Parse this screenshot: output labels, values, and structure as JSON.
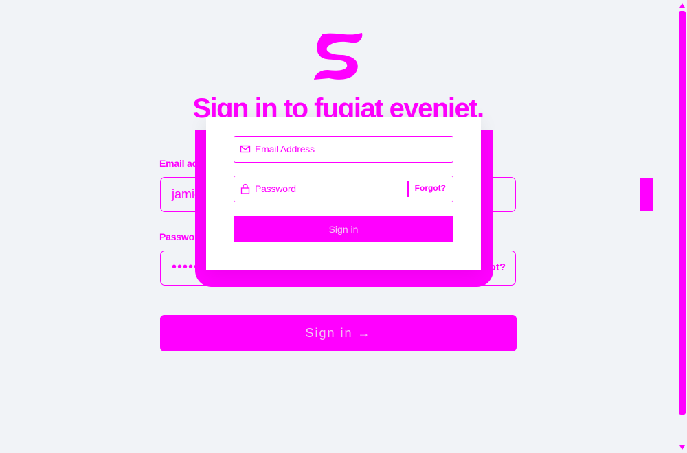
{
  "brand": {
    "logo_icon": "brand-s-logo-icon"
  },
  "heading": "Sign in to fugiat eveniet.",
  "form": {
    "email_label": "Email address",
    "email_value": "jamie@example.com",
    "password_label": "Password",
    "password_value": "••••••••••••••••",
    "forgot_label": "Forgot?",
    "submit_label": "Sign in →"
  },
  "overlay_card": {
    "email_placeholder": "Email Address",
    "password_placeholder": "Password",
    "forgot_label": "Forgot?",
    "submit_label": "Sign in"
  },
  "colors": {
    "accent": "#ff00ff",
    "background": "#f1f3f7",
    "card": "#ffffff"
  }
}
